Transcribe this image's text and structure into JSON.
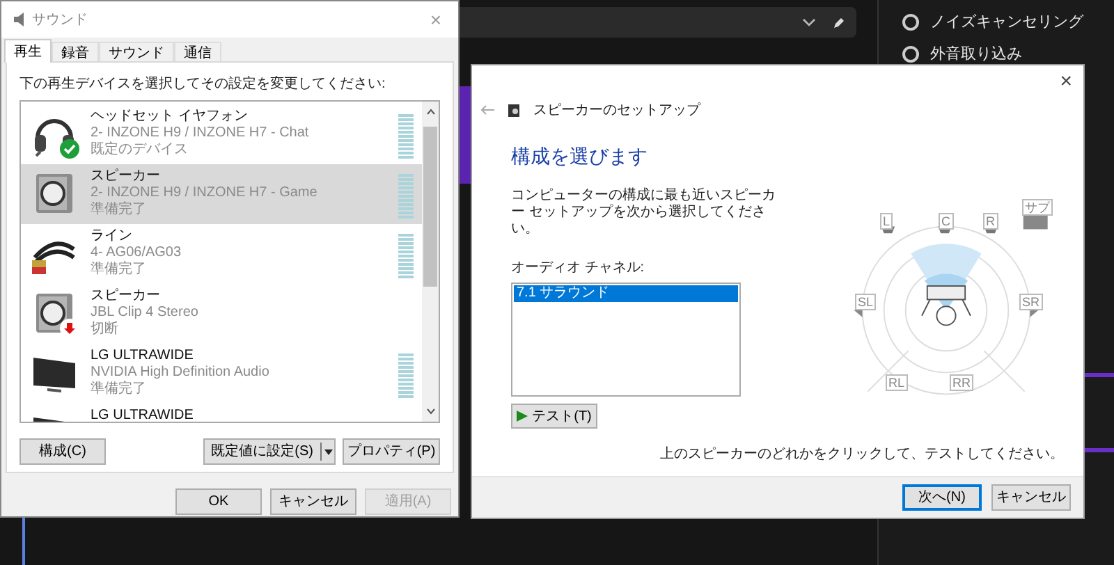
{
  "background": {
    "options": [
      {
        "label": "ノイズキャンセリング",
        "selected": false
      },
      {
        "label": "外音取り込み",
        "selected": false
      }
    ]
  },
  "sound_dialog": {
    "title": "サウンド",
    "close": "×",
    "tabs": [
      {
        "label": "再生",
        "selected": true
      },
      {
        "label": "録音",
        "selected": false
      },
      {
        "label": "サウンド",
        "selected": false
      },
      {
        "label": "通信",
        "selected": false
      }
    ],
    "instruction": "下の再生デバイスを選択してその設定を変更してください:",
    "devices": [
      {
        "kind": "headset",
        "name": "ヘッドセット イヤフォン",
        "detail": "2- INZONE H9 / INZONE H7 - Chat",
        "status": "既定のデバイス",
        "default": true,
        "disconnected": false,
        "meter": true,
        "selected": false
      },
      {
        "kind": "speaker",
        "name": "スピーカー",
        "detail": "2- INZONE H9 / INZONE H7 - Game",
        "status": "準備完了",
        "default": false,
        "disconnected": false,
        "meter": true,
        "selected": true
      },
      {
        "kind": "cable",
        "name": "ライン",
        "detail": "4- AG06/AG03",
        "status": "準備完了",
        "default": false,
        "disconnected": false,
        "meter": true,
        "selected": false
      },
      {
        "kind": "speaker",
        "name": "スピーカー",
        "detail": "JBL Clip 4 Stereo",
        "status": "切断",
        "default": false,
        "disconnected": true,
        "meter": false,
        "selected": false
      },
      {
        "kind": "monitor",
        "name": "LG ULTRAWIDE",
        "detail": "NVIDIA High Definition Audio",
        "status": "準備完了",
        "default": false,
        "disconnected": false,
        "meter": true,
        "selected": false
      },
      {
        "kind": "monitor",
        "name": "LG ULTRAWIDE",
        "default": false,
        "disconnected": false,
        "meter": false,
        "selected": false
      }
    ],
    "configure_button": "構成(C)",
    "set_default_button": "既定値に設定(S)",
    "properties_button": "プロパティ(P)",
    "footer_buttons": [
      {
        "label": "OK",
        "disabled": false
      },
      {
        "label": "キャンセル",
        "disabled": false
      },
      {
        "label": "適用(A)",
        "disabled": true
      }
    ]
  },
  "speaker_setup": {
    "close": "×",
    "title": "スピーカーのセットアップ",
    "heading": "構成を選びます",
    "description": "コンピューターの構成に最も近いスピーカー セットアップを次から選択してください。",
    "channels_label": "オーディオ チャネル:",
    "channels": [
      {
        "label": "7.1 サラウンド",
        "selected": true
      }
    ],
    "test_button": "テスト(T)",
    "speakers": [
      "L",
      "C",
      "R",
      "サブ",
      "SL",
      "SR",
      "RL",
      "RR"
    ],
    "hint": "上のスピーカーのどれかをクリックして、テストしてください。",
    "buttons": [
      {
        "label": "次へ(N)",
        "focused": true
      },
      {
        "label": "キャンセル",
        "focused": false
      }
    ]
  }
}
